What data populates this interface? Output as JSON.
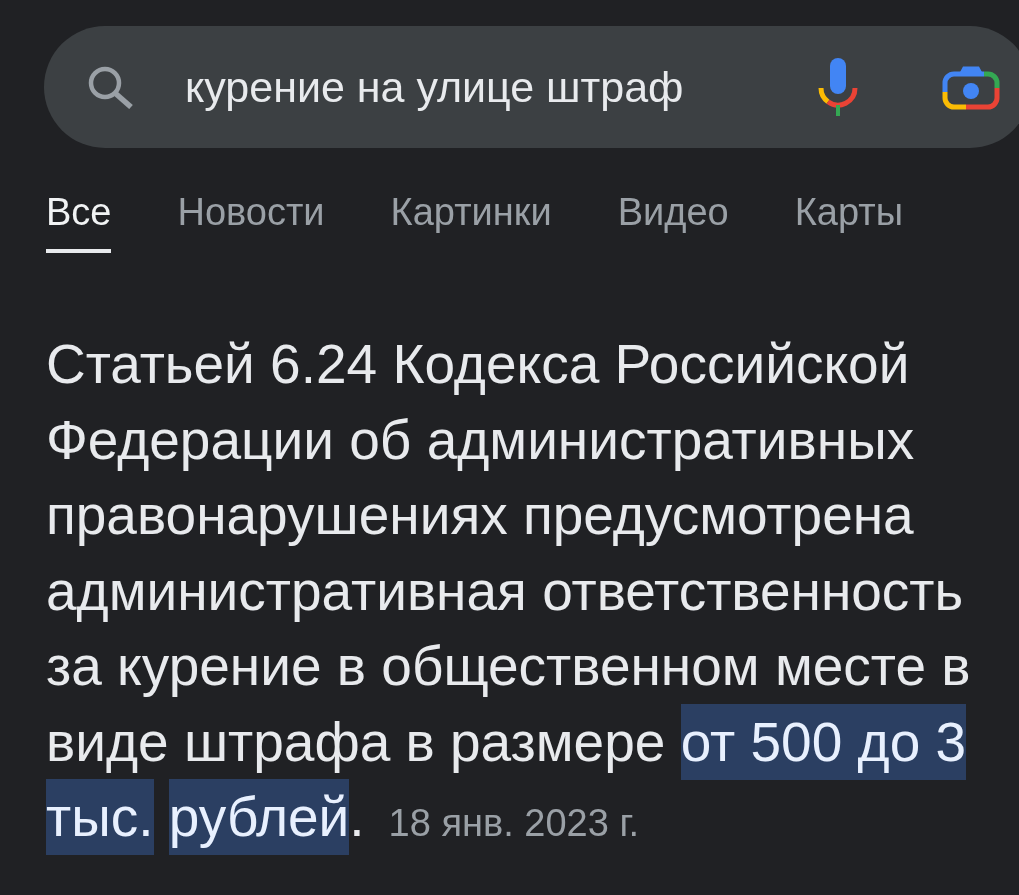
{
  "search": {
    "query": "курение на улице штраф"
  },
  "tabs": [
    {
      "label": "Все",
      "selected": true
    },
    {
      "label": "Новости",
      "selected": false
    },
    {
      "label": "Картинки",
      "selected": false
    },
    {
      "label": "Видео",
      "selected": false
    },
    {
      "label": "Карты",
      "selected": false
    }
  ],
  "answer": {
    "segments": [
      {
        "text": "Статьей 6.24 Кодекса Российской Федерации об административных правонарушениях предусмотрена административная ответственность за курение в общественном месте в виде штрафа в размере ",
        "highlighted": false
      },
      {
        "text": "от 500 до 3 тыс.",
        "highlighted": true
      },
      {
        "text": "рублей",
        "highlighted": true
      },
      {
        "text": ".",
        "highlighted": false
      }
    ],
    "date": "18 янв. 2023 г."
  }
}
